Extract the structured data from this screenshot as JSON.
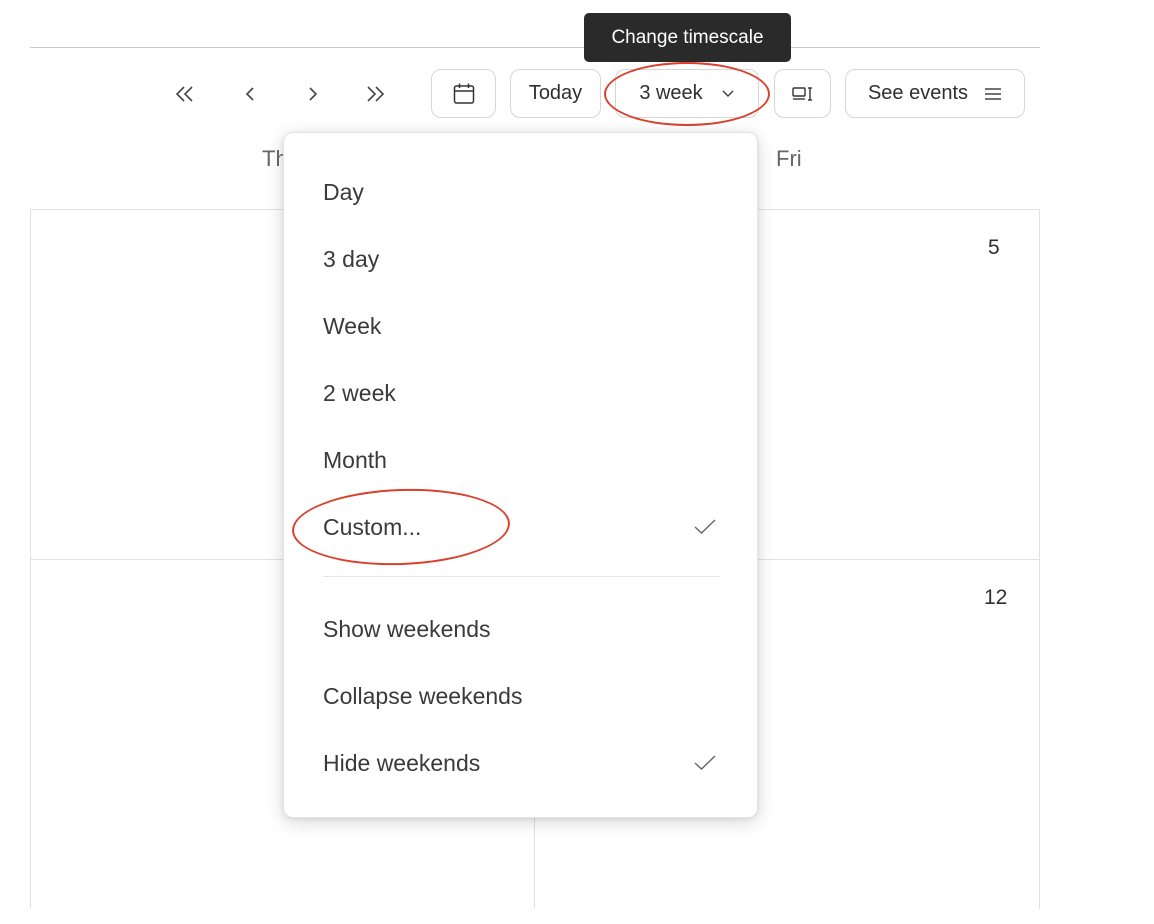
{
  "tooltip": {
    "text": "Change timescale"
  },
  "toolbar": {
    "prev_far": "«",
    "prev": "‹",
    "next": "›",
    "next_far": "»",
    "calendar_icon": "calendar-icon",
    "today_label": "Today",
    "timescale_value": "3 week",
    "layout_icon": "layout-toggle-icon",
    "see_events_label": "See events"
  },
  "day_headers": [
    "Th",
    "Fri"
  ],
  "cells": {
    "first_row_number": "5",
    "second_row_number": "12"
  },
  "timescale_menu": {
    "options": [
      {
        "label": "Day",
        "checked": false
      },
      {
        "label": "3 day",
        "checked": false
      },
      {
        "label": "Week",
        "checked": false
      },
      {
        "label": "2 week",
        "checked": false
      },
      {
        "label": "Month",
        "checked": false
      },
      {
        "label": "Custom...",
        "checked": true
      }
    ],
    "weekend_options": [
      {
        "label": "Show weekends",
        "checked": false
      },
      {
        "label": "Collapse weekends",
        "checked": false
      },
      {
        "label": "Hide weekends",
        "checked": true
      }
    ]
  },
  "colors": {
    "annotation": "#d9412c",
    "tooltip_bg": "#2a2a2a"
  }
}
